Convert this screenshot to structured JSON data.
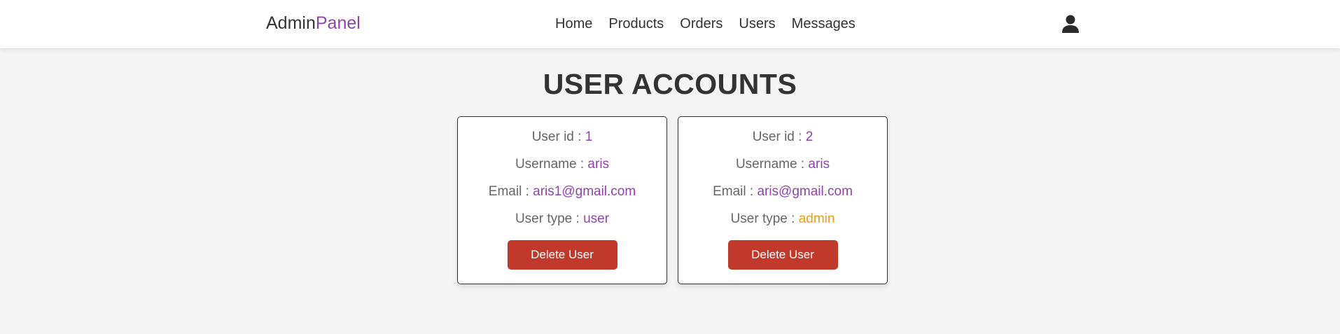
{
  "header": {
    "logo_main": "Admin",
    "logo_accent": "Panel",
    "nav": [
      "Home",
      "Products",
      "Orders",
      "Users",
      "Messages"
    ],
    "user_icon": "user-icon"
  },
  "page": {
    "title": "USER ACCOUNTS"
  },
  "labels": {
    "user_id": "User id : ",
    "username": "Username : ",
    "email": "Email : ",
    "user_type": "User type : ",
    "delete_button": "Delete User"
  },
  "users": [
    {
      "id": "1",
      "username": "aris",
      "email": "aris1@gmail.com",
      "type": "user"
    },
    {
      "id": "2",
      "username": "aris",
      "email": "aris@gmail.com",
      "type": "admin"
    }
  ],
  "colors": {
    "accent": "#8e44ad",
    "admin": "#f39c12",
    "delete": "#c0392b"
  }
}
